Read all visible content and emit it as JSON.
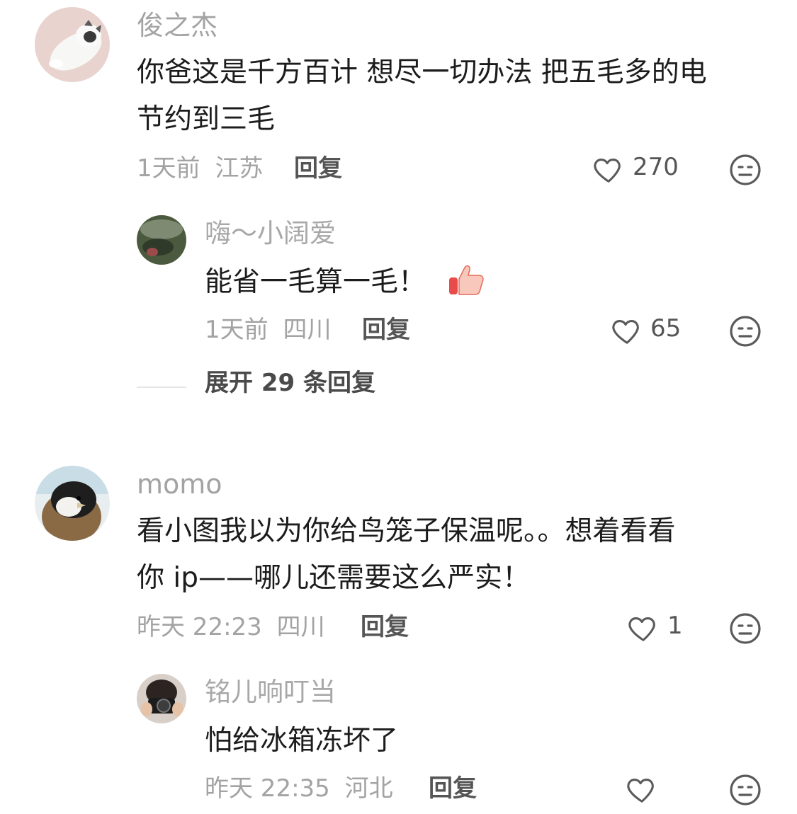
{
  "comments": [
    {
      "user": "俊之杰",
      "text_line1": "你爸这是千方百计 想尽一切办法 把五毛多的电",
      "text_line2": "节约到三毛",
      "time": "1天前",
      "location": "江苏",
      "reply_label": "回复",
      "likes": "270",
      "replies": [
        {
          "user": "嗨～小阔爱",
          "text": "能省一毛算一毛！",
          "emoji": "thumbs-up",
          "time": "1天前",
          "location": "四川",
          "reply_label": "回复",
          "likes": "65"
        }
      ],
      "expand_label": "展开 29 条回复"
    },
    {
      "user": "momo",
      "text_line1": "看小图我以为你给鸟笼子保温呢。。想着看看",
      "text_line2": "你 ip——哪儿还需要这么严实！",
      "time": "昨天 22:23",
      "location": "四川",
      "reply_label": "回复",
      "likes": "1",
      "replies": [
        {
          "user": "铭儿响叮当",
          "text": "怕给冰箱冻坏了",
          "time": "昨天 22:35",
          "location": "河北",
          "reply_label": "回复",
          "likes": ""
        }
      ]
    }
  ],
  "colors": {
    "text": "#1c1c1c",
    "muted": "#a3a3a3",
    "action": "#555555",
    "background": "#ffffff"
  },
  "icons": {
    "like": "heart-outline-icon",
    "dislike": "neutral-face-icon"
  }
}
